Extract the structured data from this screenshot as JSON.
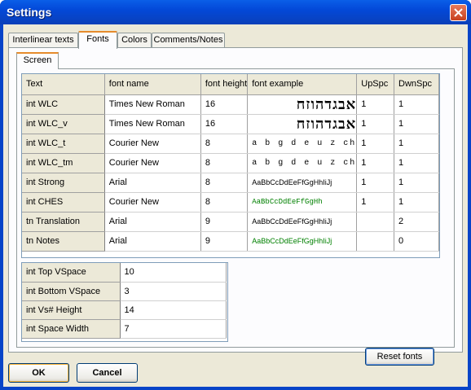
{
  "window": {
    "title": "Settings"
  },
  "tabs": [
    "Interlinear texts",
    "Fonts",
    "Colors",
    "Comments/Notes"
  ],
  "subtab": "Screen",
  "font_grid": {
    "headers": [
      "Text",
      "font name",
      "font height",
      "font example",
      "UpSpc",
      "DwnSpc"
    ],
    "rows": [
      {
        "text": "int  WLC",
        "font": "Times New Roman",
        "height": "16",
        "example": "אבגדהוזח",
        "up": "1",
        "down": "1"
      },
      {
        "text": "int  WLC_v",
        "font": "Times New Roman",
        "height": "16",
        "example": "אבגדהוזח",
        "up": "1",
        "down": "1"
      },
      {
        "text": "int  WLC_t",
        "font": "Courier New",
        "height": "8",
        "example": "a b g d e u z ch",
        "up": "1",
        "down": "1"
      },
      {
        "text": "int  WLC_tm",
        "font": "Courier New",
        "height": "8",
        "example": "a b g d e u z ch",
        "up": "1",
        "down": "1"
      },
      {
        "text": "int  Strong",
        "font": "Arial",
        "height": "8",
        "example": "AaBbCcDdEeFfGgHhIiJj",
        "up": "1",
        "down": "1"
      },
      {
        "text": "int  CHES",
        "font": "Courier New",
        "height": "8",
        "example": "AaBbCcDdEeFfGgHh",
        "up": "1",
        "down": "1"
      },
      {
        "text": "tn  Translation",
        "font": "Arial",
        "height": "9",
        "example": "AaBbCcDdEeFfGgHhIiJj",
        "up": "",
        "down": "2"
      },
      {
        "text": "tn  Notes",
        "font": "Arial",
        "height": "9",
        "example": "AaBbCcDdEeFfGgHhIiJj",
        "up": "",
        "down": "0"
      }
    ]
  },
  "spacing_grid": [
    {
      "label": "int Top VSpace",
      "value": "10"
    },
    {
      "label": "int Bottom VSpace",
      "value": "3"
    },
    {
      "label": "int Vs# Height",
      "value": "14"
    },
    {
      "label": "int Space Width",
      "value": "7"
    }
  ],
  "buttons": {
    "reset": "Reset fonts",
    "ok": "OK",
    "cancel": "Cancel"
  },
  "colors": {
    "example_green": "#008000",
    "accent_tab": "#e68b2c",
    "titlebar": "#0348d8"
  }
}
